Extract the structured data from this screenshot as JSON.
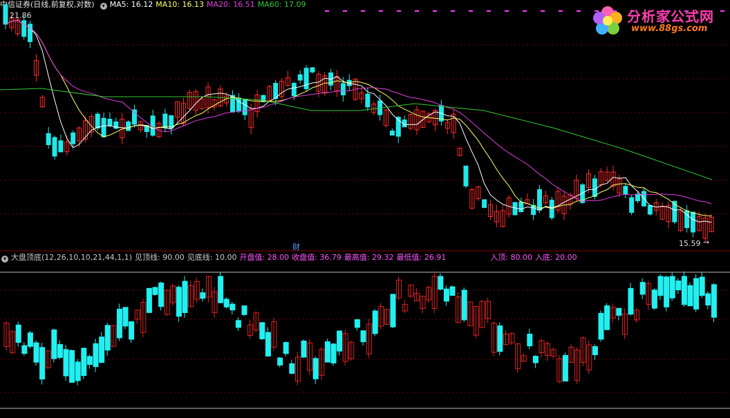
{
  "header": {
    "stock": "中信证券(日线,前复权,对数)",
    "ma5": "MA5: 16.12",
    "ma10": "MA10: 16.13",
    "ma20": "MA20: 16.51",
    "ma60": "MA60: 17.09",
    "high_label": "21.86",
    "low_label": "15.59"
  },
  "indicator": {
    "name": "大盘顶底(12,26,10,10,21,44,1,1)",
    "top_line": "见顶线: 90.00",
    "bottom_line": "见底线: 10.00",
    "open": "开盘值: 28.00",
    "close": "收盘值: 36.79",
    "high": "最高值: 29.32",
    "low": "最低值: 26.91",
    "enter_top": "入顶: 80.00",
    "enter_bottom": "入底: 20.00"
  },
  "marker": "财",
  "logo": {
    "title": "分析家公式网",
    "url": "www.88gs.com"
  },
  "colors": {
    "up": "#ff2a2a",
    "down": "#20e8e8",
    "ma5": "#ffffff",
    "ma10": "#ffff66",
    "ma20": "#e040e0",
    "ma60": "#33cc33",
    "grid": "#7a0000",
    "bg": "#000000"
  }
}
